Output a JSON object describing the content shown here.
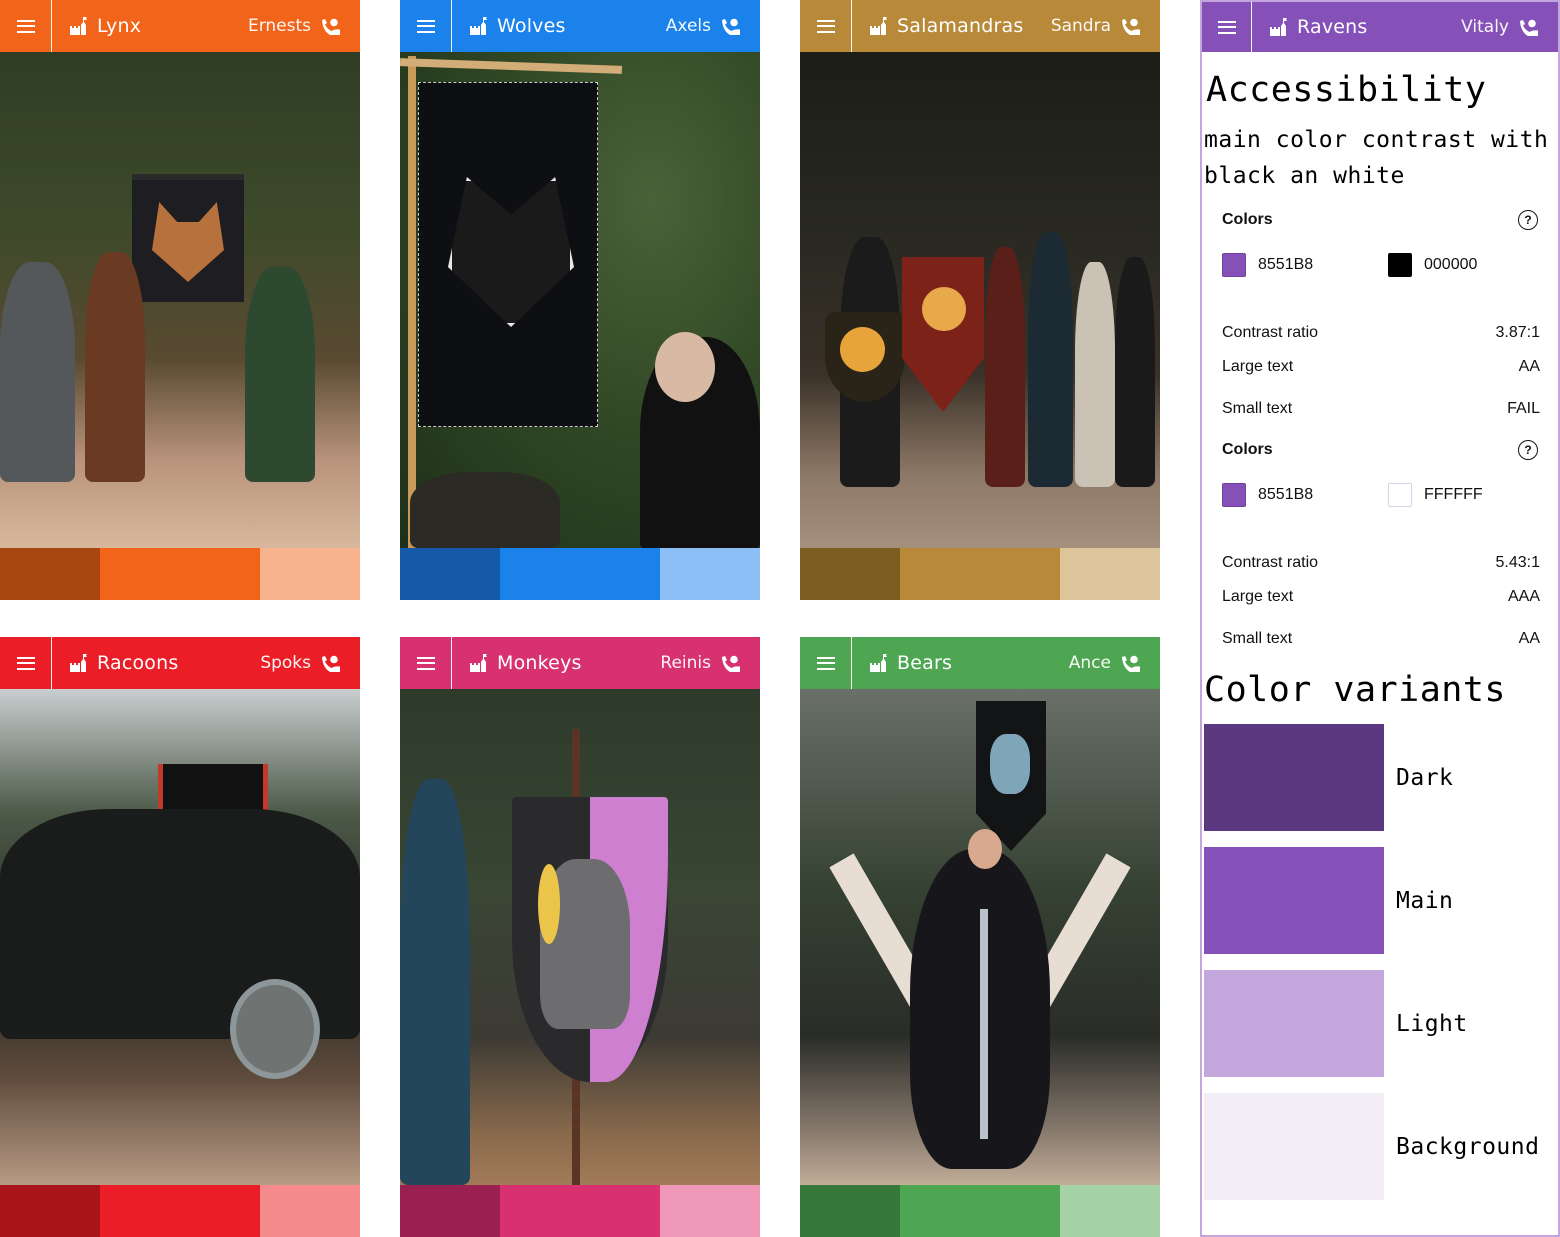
{
  "teams": {
    "lynx": {
      "name": "Lynx",
      "user": "Ernests",
      "colors": {
        "dark": "#A84712",
        "main": "#F1641A",
        "light": "#F7B38E"
      },
      "photo_alt": "Lynx team members with lynx banner in pine forest"
    },
    "wolves": {
      "name": "Wolves",
      "user": "Axels",
      "colors": {
        "dark": "#155AA8",
        "main": "#1C82EB",
        "light": "#8DBFF6"
      },
      "photo_alt": "Black banner with white wolf head and bearded man"
    },
    "salamandras": {
      "name": "Salamandras",
      "user": "Sandra",
      "colors": {
        "dark": "#7D5C22",
        "main": "#B78939",
        "light": "#DCC59A"
      },
      "photo_alt": "Salamandras team with red sun banner and shields"
    },
    "racoons": {
      "name": "Racoons",
      "user": "Spoks",
      "colors": {
        "dark": "#A7151B",
        "main": "#EB1E27",
        "light": "#F68B8E"
      },
      "photo_alt": "Racoons team posing with raccoon banner and swords"
    },
    "monkeys": {
      "name": "Monkeys",
      "user": "Reinis",
      "colors": {
        "dark": "#9A2052",
        "main": "#D8316F",
        "light": "#EF97B7"
      },
      "photo_alt": "Monkey banner with banana and mirror on pole"
    },
    "bears": {
      "name": "Bears",
      "user": "Ance",
      "colors": {
        "dark": "#36773A",
        "main": "#4EA653",
        "light": "#A5D2A6"
      },
      "photo_alt": "Woman on wooden throne under bear banner holding sword"
    }
  },
  "ravens": {
    "name": "Ravens",
    "user": "Vitaly",
    "main_color": "#8551B8",
    "accessibility": {
      "title": "Accessibility",
      "description": "main color contrast with black an white",
      "checks": [
        {
          "heading": "Colors",
          "foreground": {
            "hex_label": "8551B8",
            "color": "#8551B8"
          },
          "background": {
            "hex_label": "000000",
            "color": "#000000"
          },
          "rows": [
            {
              "label": "Contrast ratio",
              "value": "3.87:1"
            },
            {
              "label": "Large text",
              "value": "AA"
            },
            {
              "label": "Small text",
              "value": "FAIL"
            }
          ]
        },
        {
          "heading": "Colors",
          "foreground": {
            "hex_label": "8551B8",
            "color": "#8551B8"
          },
          "background": {
            "hex_label": "FFFFFF",
            "color": "#FFFFFF"
          },
          "rows": [
            {
              "label": "Contrast ratio",
              "value": "5.43:1"
            },
            {
              "label": "Large text",
              "value": "AAA"
            },
            {
              "label": "Small text",
              "value": "AA"
            }
          ]
        }
      ]
    },
    "variants": {
      "title": "Color variants",
      "items": [
        {
          "label": "Dark",
          "color": "#5C3880"
        },
        {
          "label": "Main",
          "color": "#8551B8"
        },
        {
          "label": "Light",
          "color": "#C3A6DC"
        },
        {
          "label": "Background",
          "color": "#F3EDF8"
        }
      ]
    }
  }
}
